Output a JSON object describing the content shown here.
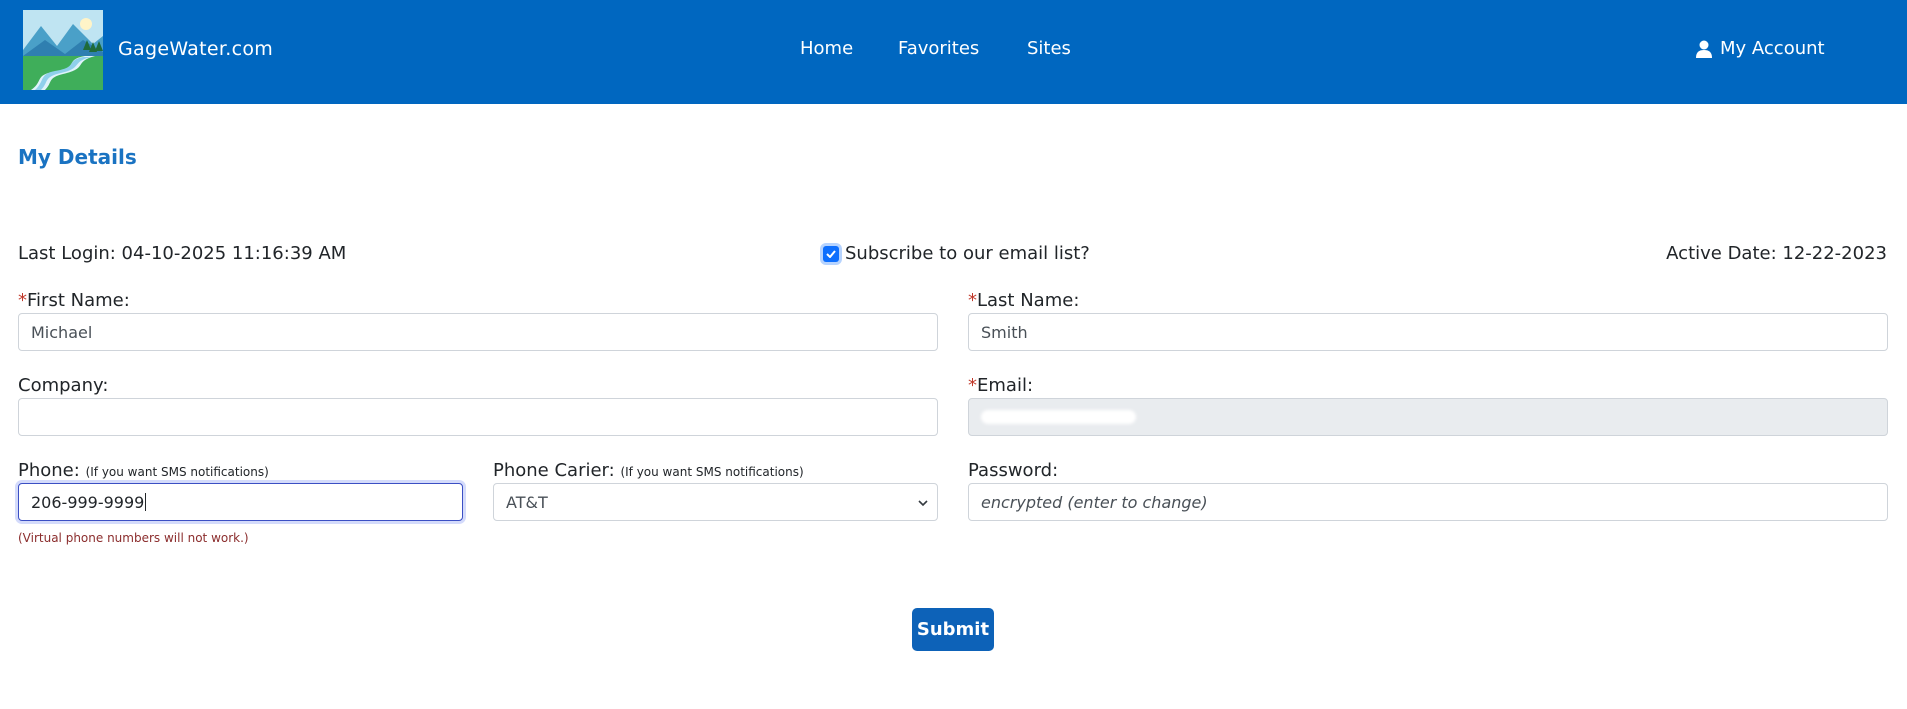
{
  "header": {
    "brand": "GageWater.com",
    "nav": [
      "Home",
      "Favorites",
      "Sites"
    ],
    "account_label": "My Account",
    "background_color": "#0067c0"
  },
  "page": {
    "title": "My Details",
    "last_login": "Last Login: 04-10-2025 11:16:39 AM",
    "subscribe_label": "Subscribe to our email list?",
    "subscribe_checked": true,
    "active_date": "Active Date: 12-22-2023"
  },
  "form": {
    "first_name": {
      "label": "First Name:",
      "required": true,
      "value": "Michael"
    },
    "last_name": {
      "label": "Last Name:",
      "required": true,
      "value": "Smith"
    },
    "company": {
      "label": "Company:",
      "value": ""
    },
    "email": {
      "label": "Email:",
      "required": true,
      "value": "",
      "disabled": true
    },
    "phone": {
      "label": "Phone:",
      "hint": "(If you want SMS notifications)",
      "value": "206-999-9999",
      "focused": true,
      "warning": "(Virtual phone numbers will not work.)"
    },
    "carrier": {
      "label": "Phone Carier:",
      "hint": "(If you want SMS notifications)",
      "selected": "AT&T"
    },
    "password": {
      "label": "Password:",
      "placeholder": "encrypted (enter to change)"
    },
    "submit_label": "Submit"
  }
}
